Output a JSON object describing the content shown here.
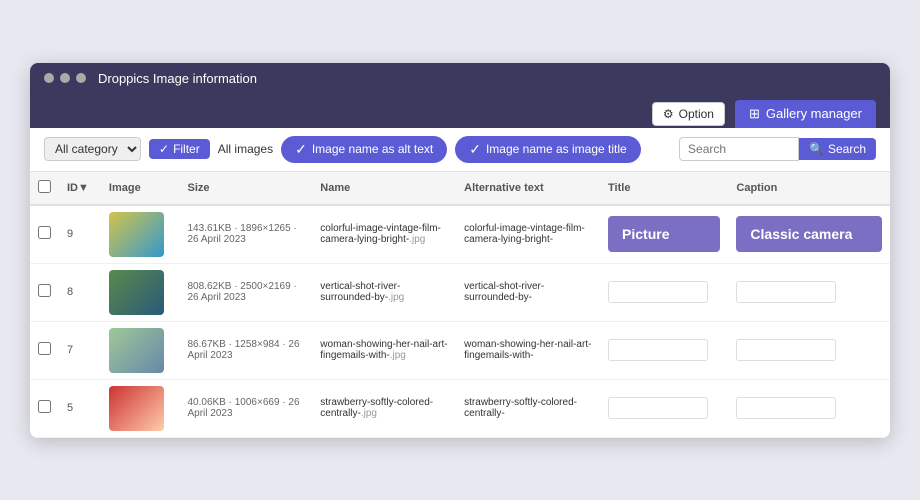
{
  "window": {
    "title": "Droppics Image information"
  },
  "toolbar": {
    "option_label": "Option",
    "gallery_manager_label": "Gallery manager"
  },
  "filter_bar": {
    "category_label": "All category",
    "filter_label": "Filter",
    "all_images_label": "All images",
    "alt_text_toggle": "Image name as alt text",
    "title_toggle": "Image name as image title",
    "search_placeholder": "Search",
    "search_btn_label": "Search"
  },
  "table": {
    "columns": [
      "ID▼",
      "Image",
      "Size",
      "Name",
      "Alternative text",
      "Title",
      "Caption"
    ],
    "rows": [
      {
        "id": "9",
        "size_info": "143.61KB · 1896×1265 · 26 April 2023",
        "name": "colorful-image-vintage-film-camera-lying-bright-",
        "ext": ".jpg",
        "alt_text": "colorful-image-vintage-film-camera-lying-bright-",
        "title_value": "Picture",
        "caption_value": "Classic camera",
        "img_color": "#d4c44a",
        "img_color2": "#3399cc"
      },
      {
        "id": "8",
        "size_info": "808.62KB · 2500×2169 · 26 April 2023",
        "name": "vertical-shot-river-surrounded-by-",
        "ext": ".jpg",
        "alt_text": "vertical-shot-river-surrounded-by-",
        "title_value": "",
        "caption_value": "",
        "img_color": "#5a8a4a",
        "img_color2": "#2a5a7a"
      },
      {
        "id": "7",
        "size_info": "86.67KB · 1258×984 · 26 April 2023",
        "name": "woman-showing-her-nail-art-fingemails-with-",
        "ext": ".jpg",
        "alt_text": "woman-showing-her-nail-art-fingemails-with-",
        "title_value": "",
        "caption_value": "",
        "img_color": "#a0c898",
        "img_color2": "#6688aa"
      },
      {
        "id": "5",
        "size_info": "40.06KB · 1006×669 · 26 April 2023",
        "name": "strawberry-softly-colored-centrally-",
        "ext": ".jpg",
        "alt_text": "strawberry-softly-colored-centrally-",
        "title_value": "",
        "caption_value": "",
        "img_color": "#cc3333",
        "img_color2": "#ffccaa"
      }
    ]
  }
}
